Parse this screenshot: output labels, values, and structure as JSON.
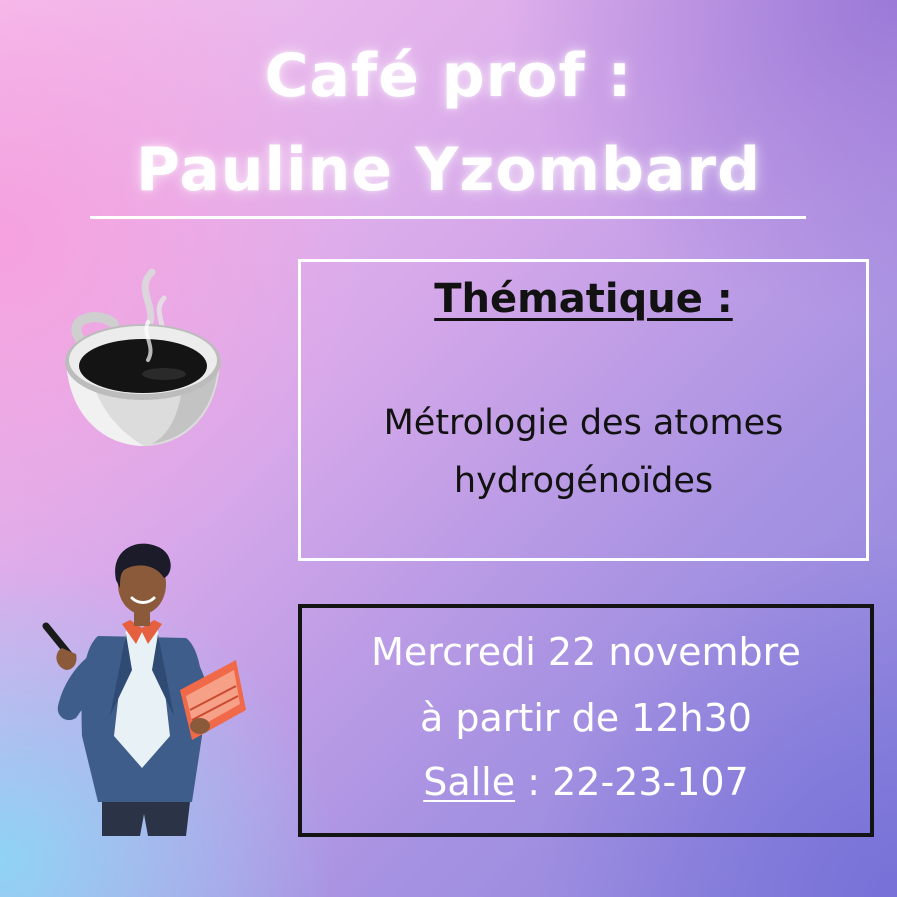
{
  "title": {
    "line1": "Café prof :",
    "line2": "Pauline Yzombard"
  },
  "theme": {
    "heading": "Thématique :",
    "text_line1": "Métrologie des atomes",
    "text_line2": "hydrogénoïdes"
  },
  "event": {
    "date": "Mercredi 22 novembre",
    "time": "à partir de 12h30",
    "room_label": "Salle",
    "room_separator": " : ",
    "room_value": "22-23-107"
  },
  "icons": {
    "coffee": "coffee-cup-icon",
    "teacher": "teacher-illustration"
  },
  "colors": {
    "text_dark": "#121212",
    "text_light": "#ffffff",
    "blazer": "#3f5d8a",
    "book": "#f06a4a"
  }
}
